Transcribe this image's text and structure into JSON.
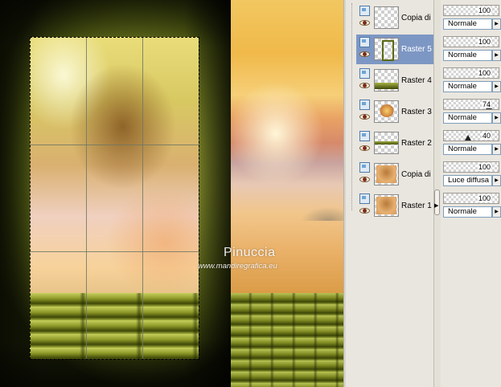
{
  "canvas": {
    "watermark_name": "Pinuccia",
    "watermark_url": "www.mandiregrafica.eu"
  },
  "layers": [
    {
      "name": "Copia di",
      "selected": false,
      "opacity": "100",
      "blend": "Normale",
      "thumb": "empty"
    },
    {
      "name": "Raster 5",
      "selected": true,
      "opacity": "100",
      "blend": "Normale",
      "thumb": "frame"
    },
    {
      "name": "Raster 4",
      "selected": false,
      "opacity": "100",
      "blend": "Normale",
      "thumb": "green-band"
    },
    {
      "name": "Raster 3",
      "selected": false,
      "opacity": "74",
      "blend": "Normale",
      "thumb": "sunset-blob"
    },
    {
      "name": "Raster 2",
      "selected": false,
      "opacity": "40",
      "blend": "Normale",
      "thumb": "thin-band"
    },
    {
      "name": "Copia di",
      "selected": false,
      "opacity": "100",
      "blend": "Luce diffusa",
      "thumb": "photo"
    },
    {
      "name": "Raster 1",
      "selected": false,
      "opacity": "100",
      "blend": "Normale",
      "thumb": "photo"
    }
  ],
  "colors": {
    "selection_highlight": "#7d97c4",
    "panel_bg": "#e9e6df"
  }
}
